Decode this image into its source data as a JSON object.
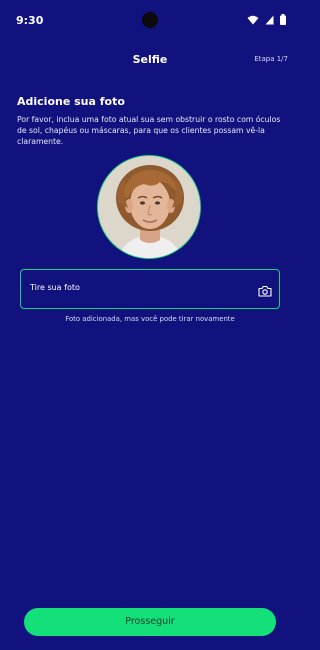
{
  "status_bar": {
    "time": "9:30",
    "icons": [
      "wifi-icon",
      "signal-icon",
      "battery-icon"
    ]
  },
  "header": {
    "title": "Selfie",
    "step": "Etapa 1/7"
  },
  "content": {
    "title": "Adicione sua foto",
    "description": "Por favor, inclua uma foto atual sua sem obstruir o rosto com óculos de sol, chapéus ou máscaras, para que os clientes possam vê-la claramente."
  },
  "photo_field": {
    "label": "Tire sua foto",
    "icon": "camera-icon",
    "hint": "Foto adicionada, mas você pode tirar novamente"
  },
  "footer": {
    "continue_label": "Prosseguir"
  },
  "colors": {
    "background": "#12127f",
    "accent": "#14e07a",
    "border": "#19d180"
  }
}
